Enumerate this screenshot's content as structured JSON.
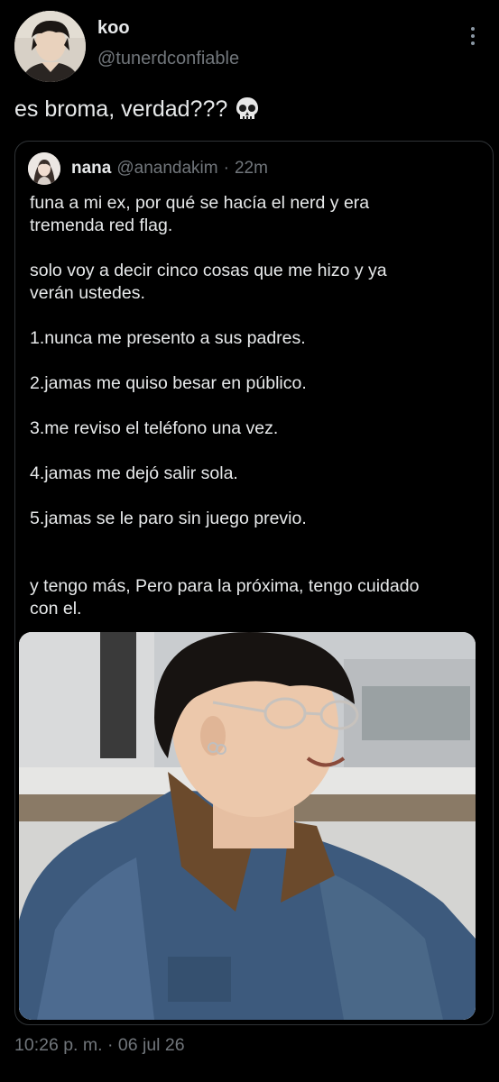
{
  "tweet": {
    "display_name": "koo",
    "handle": "@tunerdconfiable",
    "text": "es broma, verdad???",
    "emoji_icon": "skull-icon",
    "more_icon": "more-vertical-icon",
    "date": "10:26 p. m. · 06 jul 26"
  },
  "quote": {
    "display_name": "nana",
    "handle": "@anandakim",
    "separator": "·",
    "time": "22m",
    "lines": [
      "funa a mi ex, por qué se hacía el nerd y era",
      "tremenda red flag.",
      "",
      "solo voy a decir cinco cosas que me hizo y ya",
      "verán ustedes.",
      "",
      "1.nunca me presento a sus padres.",
      "",
      "2.jamas me quiso besar en público.",
      "",
      "3.me reviso el teléfono una vez.",
      "",
      "4.jamas me dejó salir sola.",
      "",
      "5.jamas se le paro sin juego previo.",
      "",
      "",
      "y tengo más, Pero para la próxima, tengo cuidado",
      "con el."
    ],
    "image_description_icon": "photo-icon"
  },
  "colors": {
    "background": "#000000",
    "text_primary": "#e7e9ea",
    "text_secondary": "#71767b",
    "border": "#2f3336"
  }
}
